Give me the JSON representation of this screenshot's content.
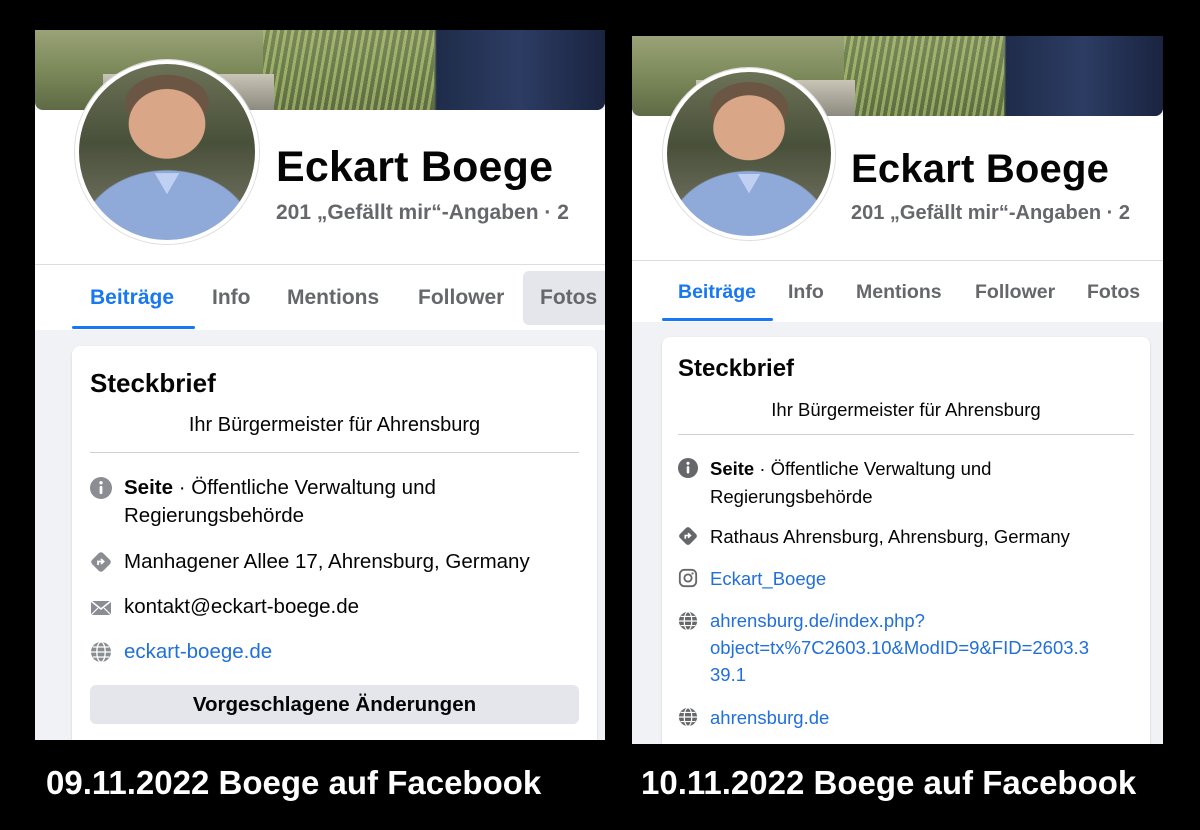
{
  "left": {
    "name": "Eckart Boege",
    "likes_text": "201 „Gefällt mir“-Angaben · 2",
    "tabs": [
      "Beiträge",
      "Info",
      "Mentions",
      "Follower",
      "Fotos"
    ],
    "active_tab": "Beiträge",
    "card": {
      "title": "Steckbrief",
      "bio": "Ihr Bürgermeister für Ahrensburg",
      "category_bold": "Seite",
      "category_rest": " · Öffentliche Verwaltung und",
      "category_line2": "Regierungsbehörde",
      "address": "Manhagener Allee 17, Ahrensburg, Germany",
      "email": "kontakt@eckart-boege.de",
      "website": "eckart-boege.de",
      "suggest_button": "Vorgeschlagene Änderungen"
    },
    "caption": "09.11.2022 Boege auf Facebook"
  },
  "right": {
    "name": "Eckart Boege",
    "likes_text": "201 „Gefällt mir“-Angaben · 2",
    "tabs": [
      "Beiträge",
      "Info",
      "Mentions",
      "Follower",
      "Fotos"
    ],
    "active_tab": "Beiträge",
    "card": {
      "title": "Steckbrief",
      "bio": "Ihr Bürgermeister für Ahrensburg",
      "category_bold": "Seite",
      "category_rest": " · Öffentliche Verwaltung und",
      "category_line2": "Regierungsbehörde",
      "address": "Rathaus Ahrensburg, Ahrensburg, Germany",
      "instagram": "Eckart_Boege",
      "website_long_1": "ahrensburg.de/index.php?",
      "website_long_2": "object=tx%7C2603.10&ModID=9&FID=2603.3",
      "website_long_3": "39.1",
      "website_short": "ahrensburg.de"
    },
    "caption": "10.11.2022 Boege auf Facebook"
  },
  "colors": {
    "accent": "#1877f2",
    "link": "#216fdb",
    "muted": "#65676b",
    "background": "#000000"
  },
  "icons": [
    "info-icon",
    "directions-icon",
    "email-icon",
    "globe-icon",
    "instagram-icon"
  ]
}
